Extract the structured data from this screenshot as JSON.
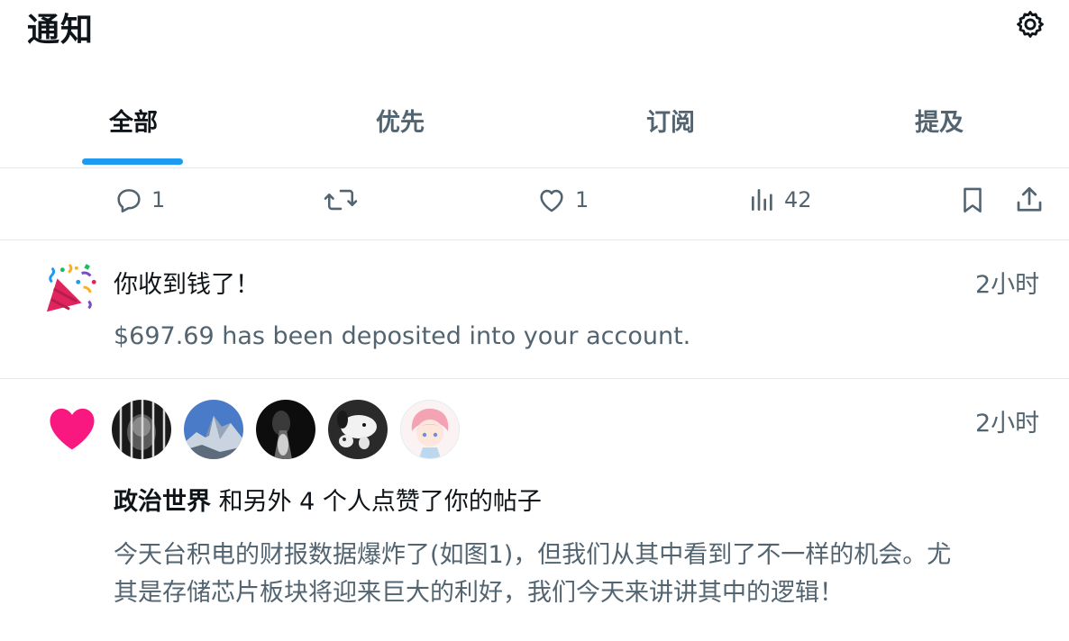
{
  "header": {
    "title": "通知",
    "settings_icon": "gear-icon"
  },
  "tabs": [
    {
      "label": "全部",
      "active": true
    },
    {
      "label": "优先",
      "active": false
    },
    {
      "label": "订阅",
      "active": false
    },
    {
      "label": "提及",
      "active": false
    }
  ],
  "accent_color": "#1d9bf0",
  "action_bar": {
    "reply": {
      "icon": "reply-icon",
      "count": "1"
    },
    "repost": {
      "icon": "repost-icon",
      "count": ""
    },
    "like": {
      "icon": "like-icon",
      "count": "1"
    },
    "views": {
      "icon": "views-icon",
      "count": "42"
    },
    "bookmark": {
      "icon": "bookmark-icon"
    },
    "share": {
      "icon": "share-icon"
    }
  },
  "notifications": [
    {
      "icon": "party-popper-icon",
      "title": "你收到钱了！",
      "time": "2小时",
      "body": "$697.69 has been deposited into your account."
    },
    {
      "icon": "heart-icon",
      "heart_color": "#f91880",
      "avatars": [
        "avatar-1",
        "avatar-2",
        "avatar-3",
        "avatar-4",
        "avatar-5"
      ],
      "time": "2小时",
      "actor": "政治世界",
      "action_text": " 和另外 4 个人点赞了你的帖子",
      "post_text": "今天台积电的财报数据爆炸了(如图1)，但我们从其中看到了不一样的机会。尤其是存储芯片板块将迎来巨大的利好，我们今天来讲讲其中的逻辑！"
    }
  ]
}
